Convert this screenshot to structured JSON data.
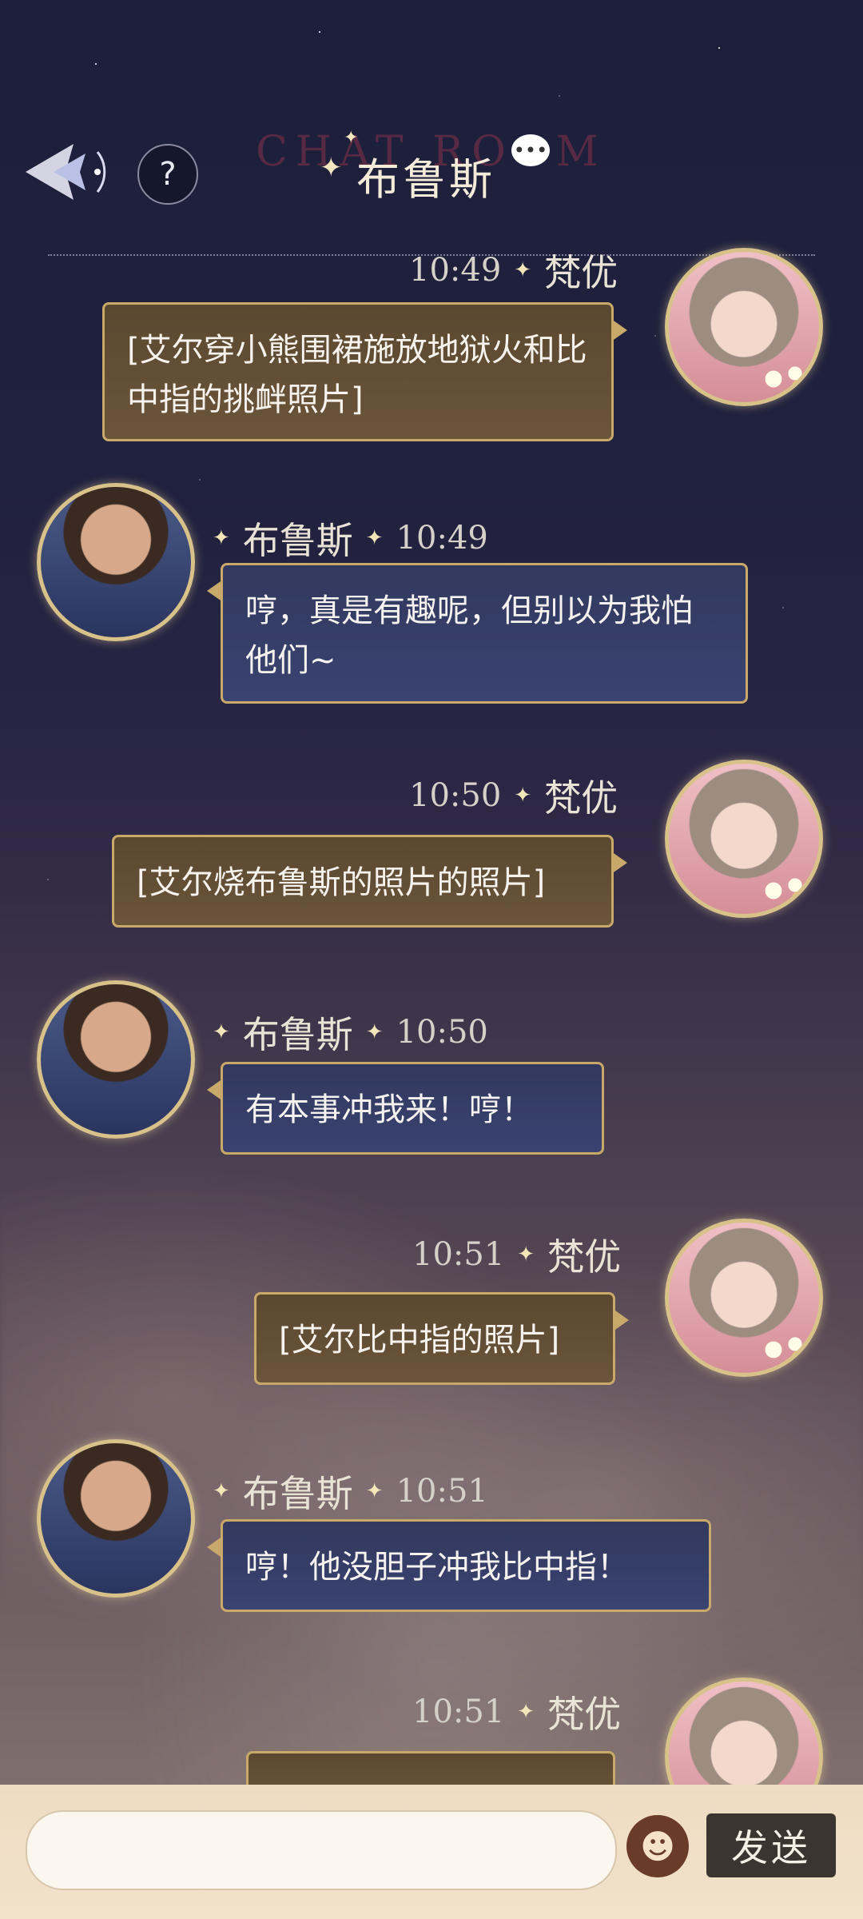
{
  "header": {
    "title": "布鲁斯",
    "bg_word": "CHAT ROOM",
    "help": "?"
  },
  "messages": [
    {
      "side": "right",
      "name": "梵优",
      "time": "10:49",
      "text": "[艾尔穿小熊围裙施放地狱火和比中指的挑衅照片]"
    },
    {
      "side": "left",
      "name": "布鲁斯",
      "time": "10:49",
      "text": "哼，真是有趣呢，但别以为我怕他们~"
    },
    {
      "side": "right",
      "name": "梵优",
      "time": "10:50",
      "text": "[艾尔烧布鲁斯的照片的照片]"
    },
    {
      "side": "left",
      "name": "布鲁斯",
      "time": "10:50",
      "text": "有本事冲我来！哼！"
    },
    {
      "side": "right",
      "name": "梵优",
      "time": "10:51",
      "text": "[艾尔比中指的照片]"
    },
    {
      "side": "left",
      "name": "布鲁斯",
      "time": "10:51",
      "text": "哼！他没胆子冲我比中指！"
    },
    {
      "side": "right",
      "name": "梵优",
      "time": "10:51",
      "text": ""
    }
  ],
  "input": {
    "placeholder": ""
  },
  "buttons": {
    "send": "发送"
  },
  "icons": {
    "back": "back-arrow-icon",
    "emoji": "emoji-icon",
    "help": "help-icon"
  }
}
